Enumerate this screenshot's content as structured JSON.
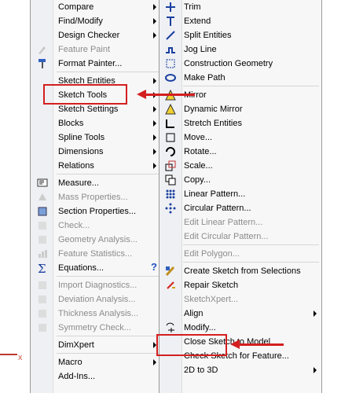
{
  "menu1": [
    {
      "label": "Compare",
      "arrow": true
    },
    {
      "label": "Find/Modify",
      "arrow": true
    },
    {
      "label": "Design Checker",
      "arrow": true
    },
    {
      "label": "Feature Paint",
      "disabled": true,
      "icon": "feature-paint-icon"
    },
    {
      "label": "Format Painter...",
      "icon": "format-painter-icon"
    },
    {
      "sep": true
    },
    {
      "label": "Sketch Entities",
      "arrow": true
    },
    {
      "label": "Sketch Tools",
      "arrow": true,
      "highlight": true
    },
    {
      "label": "Sketch Settings",
      "arrow": true
    },
    {
      "label": "Blocks",
      "arrow": true
    },
    {
      "label": "Spline Tools",
      "arrow": true
    },
    {
      "label": "Dimensions",
      "arrow": true
    },
    {
      "label": "Relations",
      "arrow": true
    },
    {
      "sep": true
    },
    {
      "label": "Measure...",
      "icon": "measure-icon"
    },
    {
      "label": "Mass Properties...",
      "disabled": true,
      "icon": "mass-properties-icon"
    },
    {
      "label": "Section Properties...",
      "icon": "section-properties-icon"
    },
    {
      "label": "Check...",
      "disabled": true,
      "icon": "check-icon"
    },
    {
      "label": "Geometry Analysis...",
      "disabled": true,
      "icon": "geometry-analysis-icon"
    },
    {
      "label": "Feature Statistics...",
      "disabled": true,
      "icon": "feature-statistics-icon"
    },
    {
      "label": "Equations...",
      "icon": "equations-icon",
      "help": true
    },
    {
      "sep": true
    },
    {
      "label": "Import Diagnostics...",
      "disabled": true,
      "icon": "import-diagnostics-icon"
    },
    {
      "label": "Deviation  Analysis...",
      "disabled": true,
      "icon": "deviation-analysis-icon"
    },
    {
      "label": "Thickness Analysis...",
      "disabled": true,
      "icon": "thickness-analysis-icon"
    },
    {
      "label": "Symmetry Check...",
      "disabled": true,
      "icon": "symmetry-check-icon"
    },
    {
      "sep": true
    },
    {
      "label": "DimXpert",
      "arrow": true
    },
    {
      "sep": true
    },
    {
      "label": "Macro",
      "arrow": true
    },
    {
      "label": "Add-Ins..."
    }
  ],
  "menu2": [
    {
      "label": "Trim",
      "icon": "trim-icon"
    },
    {
      "label": "Extend",
      "icon": "extend-icon"
    },
    {
      "label": "Split Entities",
      "icon": "split-entities-icon"
    },
    {
      "label": "Jog Line",
      "icon": "jog-line-icon"
    },
    {
      "label": "Construction Geometry",
      "icon": "construction-geometry-icon"
    },
    {
      "label": "Make Path",
      "icon": "make-path-icon"
    },
    {
      "sep": true
    },
    {
      "label": "Mirror",
      "icon": "mirror-icon"
    },
    {
      "label": "Dynamic Mirror",
      "icon": "dynamic-mirror-icon"
    },
    {
      "label": "Stretch Entities",
      "icon": "stretch-entities-icon"
    },
    {
      "label": "Move...",
      "icon": "move-icon"
    },
    {
      "label": "Rotate...",
      "icon": "rotate-icon"
    },
    {
      "label": "Scale...",
      "icon": "scale-icon"
    },
    {
      "label": "Copy...",
      "icon": "copy-icon"
    },
    {
      "label": "Linear Pattern...",
      "icon": "linear-pattern-icon"
    },
    {
      "label": "Circular Pattern...",
      "icon": "circular-pattern-icon"
    },
    {
      "label": "Edit Linear Pattern...",
      "disabled": true
    },
    {
      "label": "Edit Circular Pattern...",
      "disabled": true
    },
    {
      "sep": true
    },
    {
      "label": "Edit Polygon...",
      "disabled": true
    },
    {
      "sep": true
    },
    {
      "label": "Create Sketch from Selections",
      "icon": "create-sketch-icon"
    },
    {
      "label": "Repair Sketch",
      "icon": "repair-sketch-icon"
    },
    {
      "label": "SketchXpert...",
      "disabled": true
    },
    {
      "label": "Align",
      "arrow": true
    },
    {
      "label": "Modify...",
      "icon": "modify-icon",
      "highlight": true
    },
    {
      "label": "Close Sketch to Model"
    },
    {
      "label": "Check Sketch for Feature..."
    },
    {
      "label": "2D to 3D",
      "arrow": true
    }
  ],
  "help_glyph": "?",
  "x_label": "X",
  "colors": {
    "accent": "#d41f1f",
    "menu_bg": "#f7f7f7",
    "gutter": "#eef0f3"
  }
}
